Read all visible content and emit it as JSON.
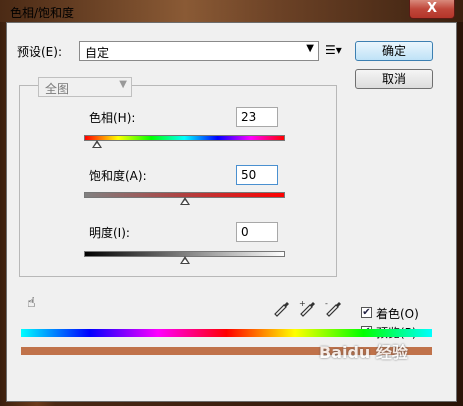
{
  "window": {
    "title": "色相/饱和度",
    "close": "X"
  },
  "preset": {
    "label": "预设(E):",
    "value": "自定"
  },
  "buttons": {
    "ok": "确定",
    "cancel": "取消"
  },
  "channel": {
    "value": "全图"
  },
  "hue": {
    "label": "色相(H):",
    "value": "23",
    "level": 23,
    "min": -180,
    "max": 180
  },
  "saturation": {
    "label": "饱和度(A):",
    "value": "50",
    "level": 50,
    "min": 0,
    "max": 100
  },
  "lightness": {
    "label": "明度(I):",
    "value": "0",
    "level": 0,
    "min": -100,
    "max": 100
  },
  "options": {
    "colorize": "着色(O)",
    "preview": "预览(P)"
  },
  "watermark": "Baidu 经验",
  "colors": {
    "accent": "#3c7fb1",
    "colorized_bar": "#c0724a"
  }
}
